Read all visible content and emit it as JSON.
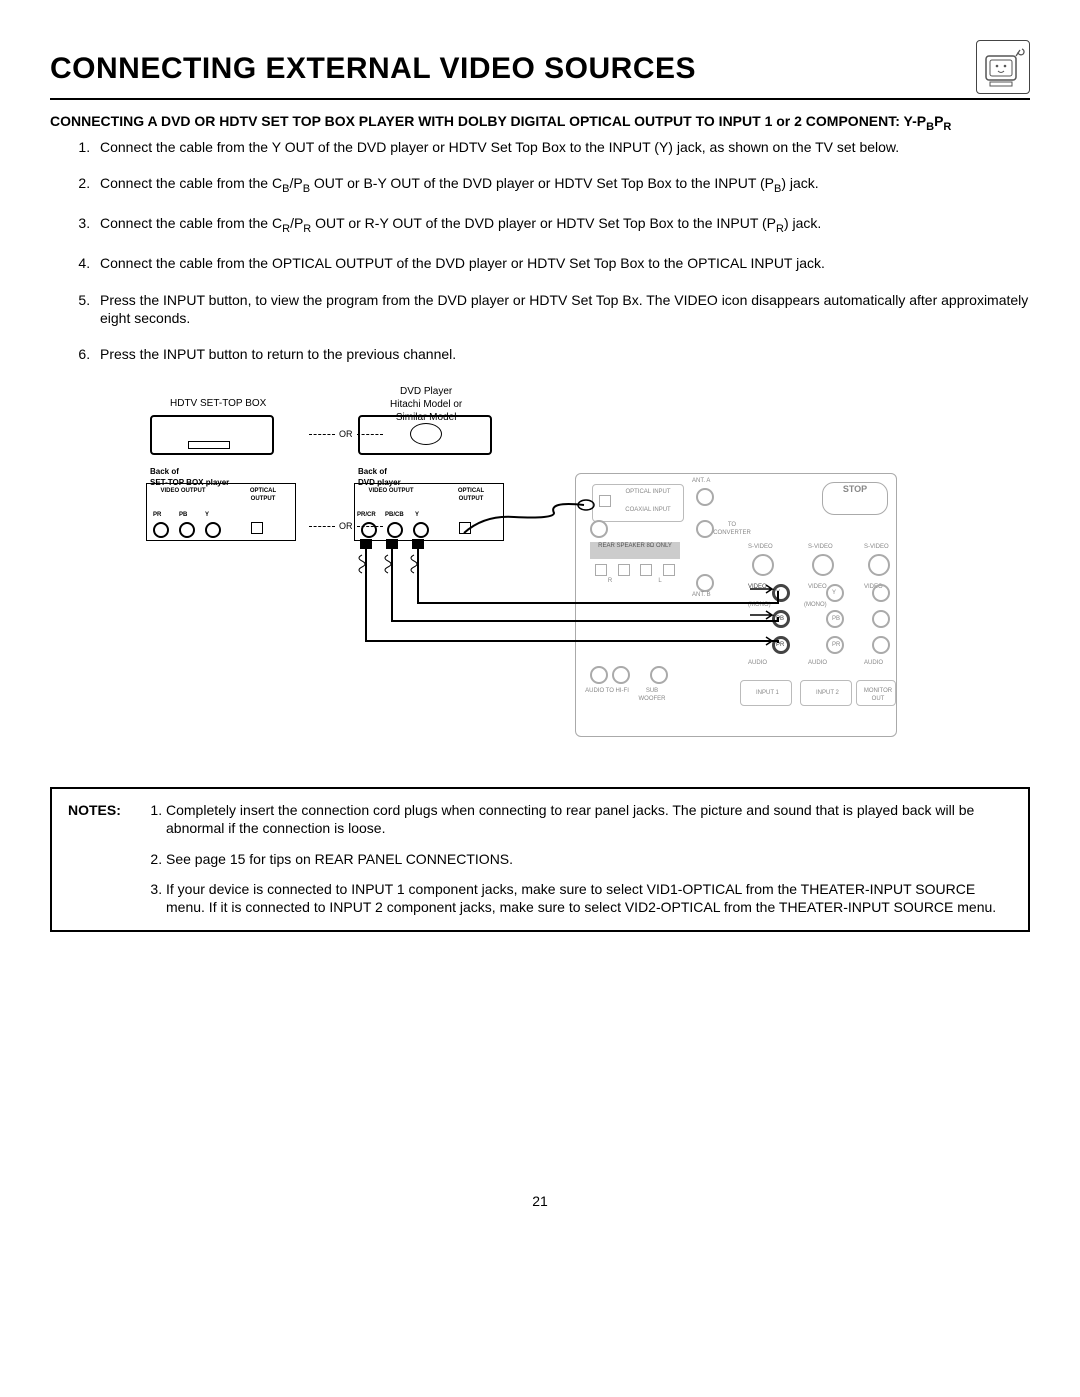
{
  "title": "CONNECTING EXTERNAL VIDEO SOURCES",
  "subtitle_prefix": "CONNECTING A DVD OR HDTV SET TOP BOX PLAYER WITH DOLBY DIGITAL OPTICAL OUTPUT TO INPUT 1 or 2 COMPONENT: Y-P",
  "subtitle_sub1": "B",
  "subtitle_mid": "P",
  "subtitle_sub2": "R",
  "steps": {
    "s1": "Connect the cable from the Y OUT of the DVD player or HDTV Set Top Box to the INPUT (Y) jack, as shown on the TV set below.",
    "s2a": "Connect the cable from the C",
    "s2b": "B",
    "s2c": "/P",
    "s2d": "B",
    "s2e": " OUT or B-Y OUT of the DVD player or HDTV Set Top Box to the INPUT (P",
    "s2f": "B",
    "s2g": ") jack.",
    "s3a": "Connect the cable from the C",
    "s3b": "R",
    "s3c": "/P",
    "s3d": "R",
    "s3e": " OUT or R-Y OUT of the DVD player or HDTV Set Top Box to the INPUT (P",
    "s3f": "R",
    "s3g": ") jack.",
    "s4": "Connect the cable from the OPTICAL OUTPUT of the DVD player or HDTV Set Top Box to the OPTICAL INPUT jack.",
    "s5": "Press the INPUT button, to view the program from the DVD player or HDTV Set Top Bx.  The VIDEO icon disappears automatically after approximately eight seconds.",
    "s6": "Press the INPUT button to return to the previous channel."
  },
  "diagram": {
    "stb_label": "HDTV SET-TOP BOX",
    "dvd_label_l1": "DVD Player",
    "dvd_label_l2": "Hitachi Model or",
    "dvd_label_l3": "Similar Model",
    "or": "OR",
    "backof_stb_l1": "Back of",
    "backof_stb_l2": "SET-TOP BOX player",
    "backof_dvd_l1": "Back of",
    "backof_dvd_l2": "DVD player",
    "video_output": "VIDEO OUTPUT",
    "optical_output": "OPTICAL OUTPUT",
    "pr": "PR",
    "pb": "PB",
    "y": "Y",
    "prcr": "PR/CR",
    "pbcb": "PB/CB",
    "rear": {
      "stop": "STOP",
      "optical_input": "OPTICAL INPUT",
      "coaxial_input": "COAXIAL INPUT",
      "rear_speaker": "REAR SPEAKER 8Ω ONLY",
      "ant_a": "ANT. A",
      "ant_b": "ANT. B",
      "to_converter": "TO CONVERTER",
      "svideo": "S-VIDEO",
      "video": "VIDEO",
      "mono": "(MONO)",
      "audio": "AUDIO",
      "audio_tohifi": "AUDIO TO HI-FI",
      "sub_woofer": "SUB WOOFER",
      "input1": "INPUT 1",
      "input2": "INPUT 2",
      "monitor_out": "MONITOR OUT",
      "y": "Y",
      "pb": "PB",
      "pr": "PR",
      "r": "R",
      "l": "L"
    }
  },
  "notes_label": "NOTES:",
  "notes": {
    "n1": "Completely insert the connection cord plugs when connecting to rear panel jacks.  The picture and sound that is played back will be abnormal if the connection is loose.",
    "n2": "See page 15 for tips on REAR PANEL CONNECTIONS.",
    "n3": "If your device is connected to INPUT 1 component jacks, make sure to select VID1-OPTICAL from the THEATER-INPUT SOURCE menu.  If it is connected to INPUT 2 component jacks, make sure to select VID2-OPTICAL from the THEATER-INPUT SOURCE menu."
  },
  "page_number": "21"
}
